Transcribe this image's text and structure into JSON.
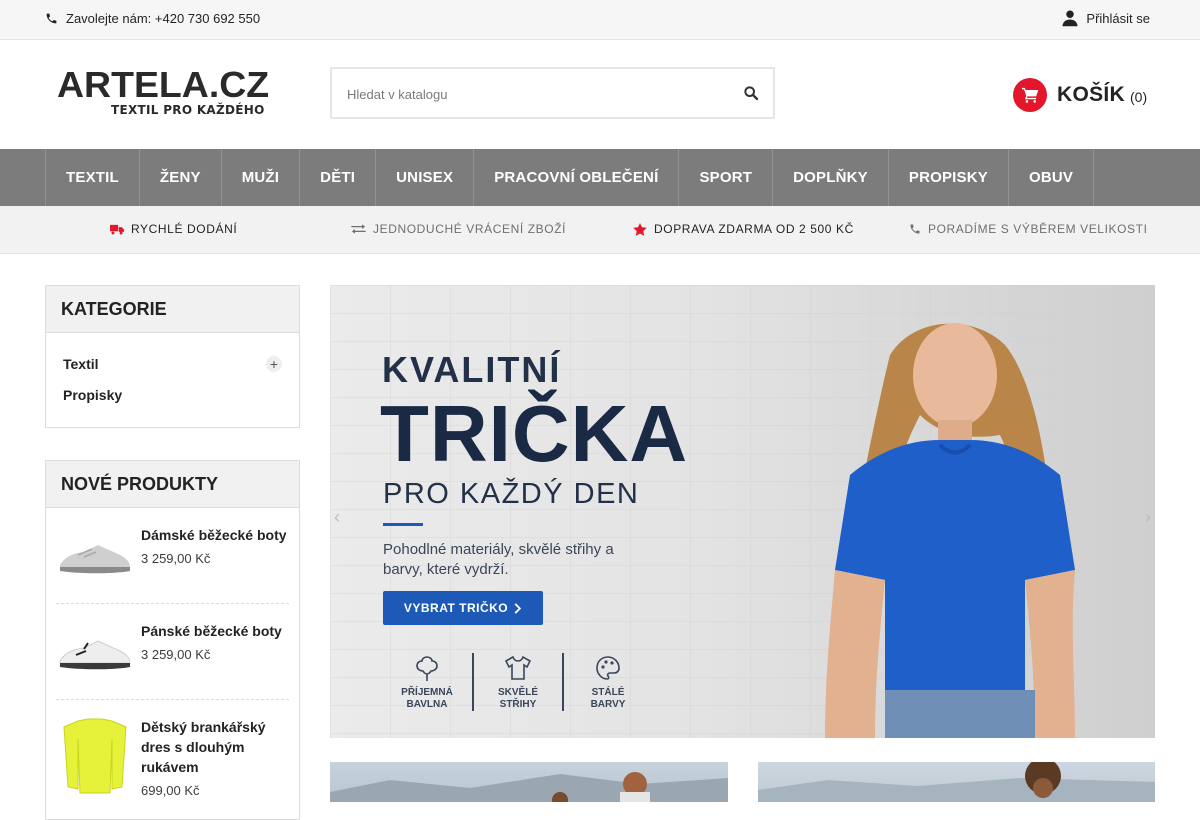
{
  "topbar": {
    "phone_label": "Zavolejte nám:",
    "phone_number": "+420 730 692 550",
    "login_label": "Přihlásit se"
  },
  "header": {
    "logo_text": "ARTELA.CZ",
    "logo_tagline": "TEXTIL PRO KAŽDÉHO",
    "search_placeholder": "Hledat v katalogu",
    "cart_label": "KOŠÍK",
    "cart_count": "(0)"
  },
  "nav": {
    "items": [
      {
        "label": "TEXTIL"
      },
      {
        "label": "ŽENY"
      },
      {
        "label": "MUŽI"
      },
      {
        "label": "DĚTI"
      },
      {
        "label": "UNISEX"
      },
      {
        "label": "PRACOVNÍ OBLEČENÍ"
      },
      {
        "label": "SPORT"
      },
      {
        "label": "DOPLŇKY"
      },
      {
        "label": "PROPISKY"
      },
      {
        "label": "OBUV"
      }
    ]
  },
  "benefits": [
    {
      "label": "RYCHLÉ DODÁNÍ",
      "icon": "truck-icon"
    },
    {
      "label": "JEDNODUCHÉ VRÁCENÍ ZBOŽÍ",
      "icon": "exchange-icon"
    },
    {
      "label": "DOPRAVA ZDARMA OD 2 500 KČ",
      "icon": "star-icon"
    },
    {
      "label": "PORADÍME S VÝBĚREM VELIKOSTI",
      "icon": "phone-icon"
    }
  ],
  "sidebar": {
    "categories_title": "KATEGORIE",
    "categories": [
      {
        "label": "Textil",
        "expandable": "+"
      },
      {
        "label": "Propisky"
      }
    ],
    "new_products_title": "NOVÉ PRODUKTY",
    "new_products": [
      {
        "name": "Dámské běžecké boty",
        "price": "3 259,00 Kč"
      },
      {
        "name": "Pánské běžecké boty",
        "price": "3 259,00 Kč"
      },
      {
        "name": "Dětský brankářský dres s dlouhým rukávem",
        "price": "699,00 Kč"
      }
    ]
  },
  "hero": {
    "line1": "KVALITNÍ",
    "line2": "TRIČKA",
    "line3": "PRO KAŽDÝ DEN",
    "description": "Pohodlné materiály, skvělé střihy a barvy, které vydrží.",
    "cta_label": "VYBRAT TRIČKO",
    "features": [
      {
        "label": "PŘÍJEMNÁ\nBAVLNA",
        "icon": "cotton-icon"
      },
      {
        "label": "SKVĚLÉ\nSTŘIHY",
        "icon": "tshirt-icon"
      },
      {
        "label": "STÁLÉ\nBARVY",
        "icon": "palette-icon"
      }
    ]
  },
  "colors": {
    "accent_red": "#e3162b",
    "nav_grey": "#7c7c7c",
    "hero_blue": "#1d5ab8",
    "hero_navy": "#1b2a44"
  }
}
